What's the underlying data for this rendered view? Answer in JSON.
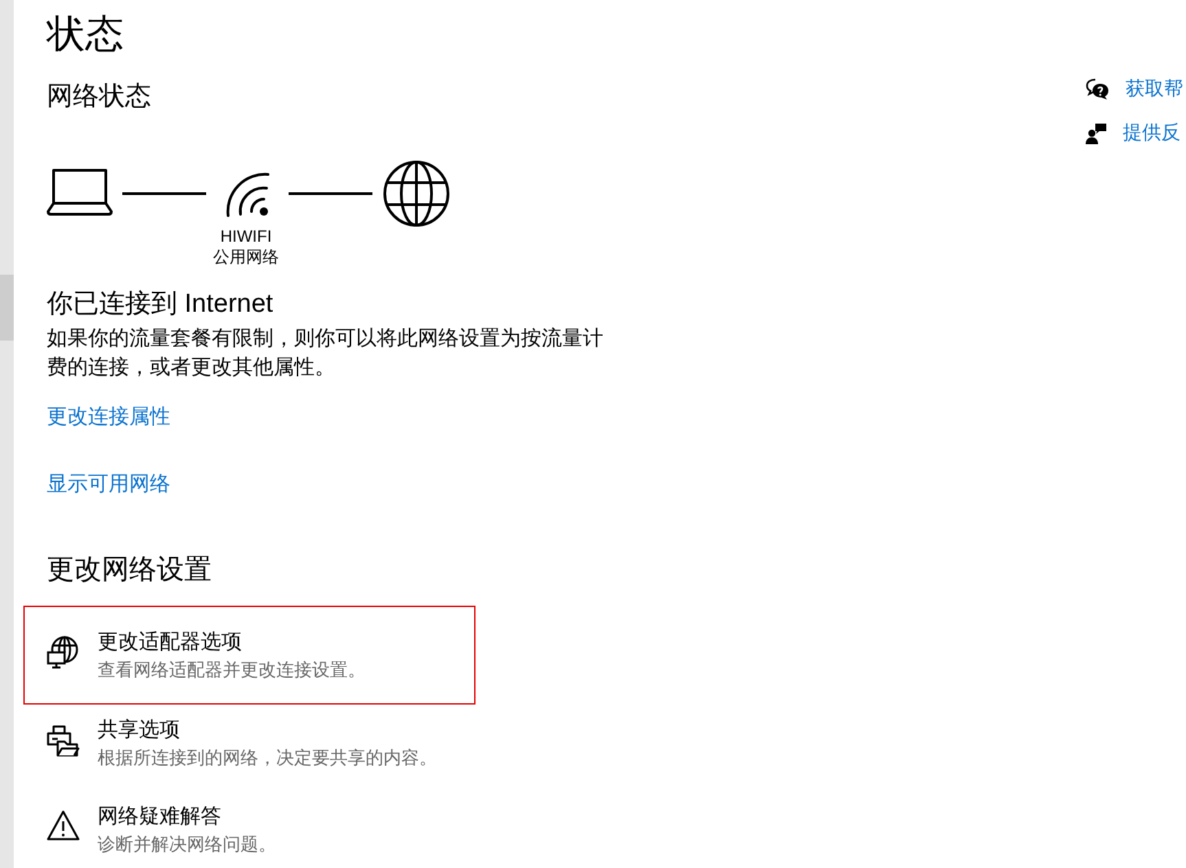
{
  "page": {
    "title": "状态"
  },
  "network_status": {
    "heading": "网络状态",
    "network": {
      "name": "HIWIFI",
      "type": "公用网络"
    }
  },
  "connection": {
    "heading": "你已连接到 Internet",
    "description": "如果你的流量套餐有限制，则你可以将此网络设置为按流量计费的连接，或者更改其他属性。",
    "links": [
      {
        "label": "更改连接属性"
      },
      {
        "label": "显示可用网络"
      }
    ]
  },
  "change_network_settings": {
    "heading": "更改网络设置",
    "items": [
      {
        "kind": "adapter",
        "title": "更改适配器选项",
        "description": "查看网络适配器并更改连接设置。",
        "highlighted": true
      },
      {
        "kind": "sharing",
        "title": "共享选项",
        "description": "根据所连接到的网络，决定要共享的内容。",
        "highlighted": false
      },
      {
        "kind": "troubleshoot",
        "title": "网络疑难解答",
        "description": "诊断并解决网络问题。",
        "highlighted": false
      }
    ]
  },
  "help_links": [
    {
      "kind": "help",
      "label": "获取帮"
    },
    {
      "kind": "feedback",
      "label": "提供反"
    }
  ]
}
